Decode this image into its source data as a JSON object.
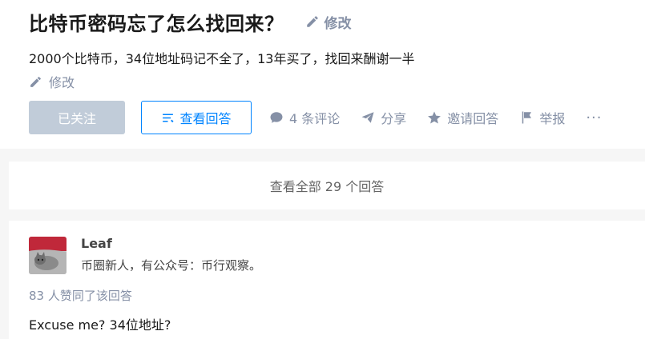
{
  "question": {
    "title": "比特币密码忘了怎么找回来？",
    "title_edit_label": "修改",
    "description": "2000个比特币，34位地址码记不全了，13年买了，找回来酬谢一半",
    "desc_edit_label": "修改"
  },
  "actions": {
    "follow_label": "已关注",
    "view_answer_label": "查看回答",
    "comment_label": "4 条评论",
    "share_label": "分享",
    "invite_label": "邀请回答",
    "report_label": "举报",
    "more_label": "···"
  },
  "all_answers": {
    "label": "查看全部 29 个回答"
  },
  "answer": {
    "author_name": "Leaf",
    "author_bio": "币圈新人，有公众号：币行观察。",
    "vote_info": "83 人赞同了该回答",
    "content": "Excuse me? 34位地址?"
  },
  "colors": {
    "accent": "#0084ff",
    "muted": "#8590a6",
    "follow_bg": "#c1ccd9"
  },
  "icons": [
    "pencil-icon",
    "list-icon",
    "comment-icon",
    "paper-plane-icon",
    "star-icon",
    "flag-icon",
    "avatar-image"
  ]
}
